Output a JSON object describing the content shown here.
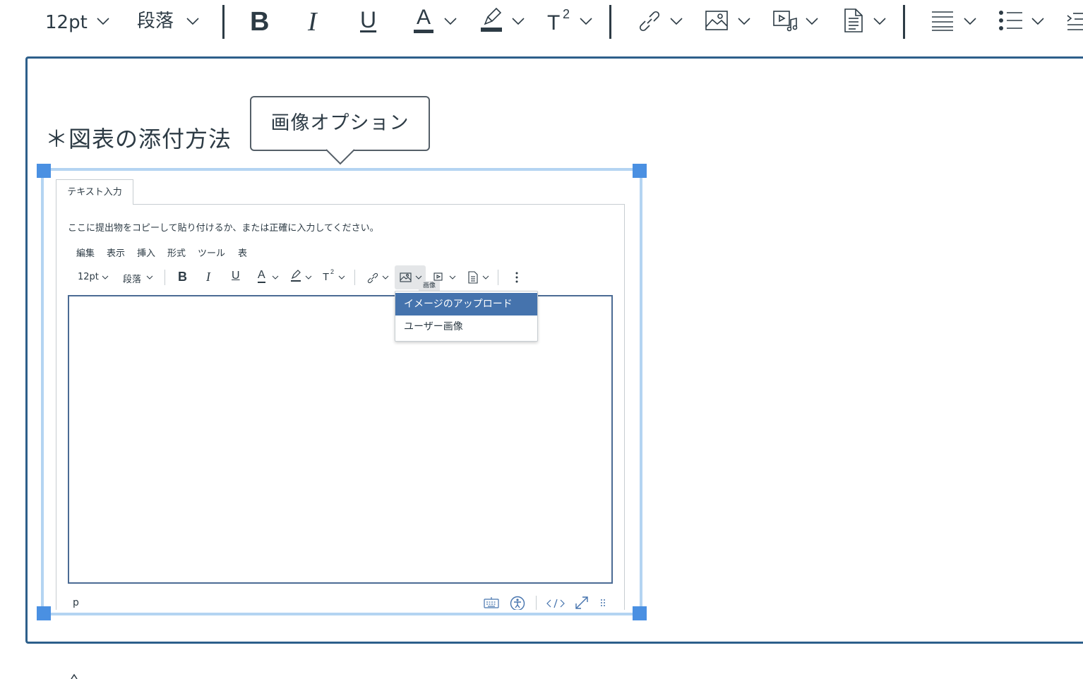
{
  "toolbar": {
    "font_size": "12pt",
    "block_format": "段落",
    "bold": "B",
    "italic": "I",
    "underline": "U",
    "text_color": "A",
    "superscript": "T",
    "superscript_mark": "2",
    "icons": [
      "chevron-down-icon",
      "link-icon",
      "image-icon",
      "media-icon",
      "document-icon",
      "align-icon",
      "bullet-list-icon",
      "indent-icon"
    ]
  },
  "editor": {
    "heading": "＊図表の添付方法",
    "tooltip": "画像オプション"
  },
  "embedded": {
    "tab_label": "テキスト入力",
    "instruction": "ここに提出物をコピーして貼り付けるか、または正確に入力してください。",
    "menu": [
      "編集",
      "表示",
      "挿入",
      "形式",
      "ツール",
      "表"
    ],
    "toolbar": {
      "font_size": "12pt",
      "block_format": "段落",
      "bold": "B",
      "italic": "I",
      "underline": "U",
      "text_color": "A",
      "superscript": "T",
      "superscript_mark": "2"
    },
    "image_tooltip": "画像",
    "dropdown": {
      "upload": "イメージのアップロード",
      "user_images": "ユーザー画像"
    },
    "status_path": "p",
    "status_icons": [
      "keyboard-icon",
      "accessibility-icon",
      "html-code-icon",
      "fullscreen-icon",
      "resize-grip-icon"
    ]
  },
  "colors": {
    "frame_border": "#2d5f8b",
    "selection": "#b4d4f2",
    "handle": "#4a90e2",
    "dropdown_highlight": "#4573ad",
    "text": "#2d3b45"
  }
}
